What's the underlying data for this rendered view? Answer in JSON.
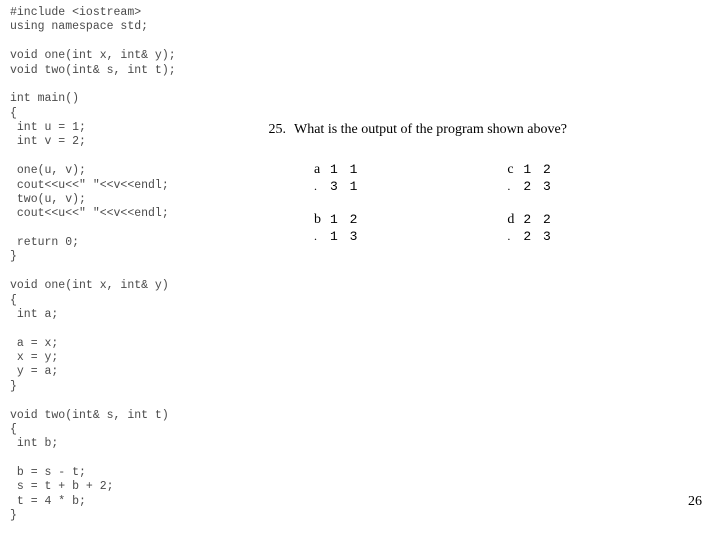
{
  "code": "#include <iostream>\nusing namespace std;\n\nvoid one(int x, int& y);\nvoid two(int& s, int t);\n\nint main()\n{\n int u = 1;\n int v = 2;\n\n one(u, v);\n cout<<u<<\" \"<<v<<endl;\n two(u, v);\n cout<<u<<\" \"<<v<<endl;\n\n return 0;\n}\n\nvoid one(int x, int& y)\n{\n int a;\n\n a = x;\n x = y;\n y = a;\n}\n\nvoid two(int& s, int t)\n{\n int b;\n\n b = s - t;\n s = t + b + 2;\n t = 4 * b;\n}",
  "question": {
    "number": "25.",
    "text": "What is the output of the program shown above?"
  },
  "choices": {
    "a": {
      "label": "a",
      "line1": "1 1",
      "line2": "3 1"
    },
    "b": {
      "label": "b",
      "line1": "1 2",
      "line2": "1 3"
    },
    "c": {
      "label": "c",
      "line1": "1 2",
      "line2": "2 3"
    },
    "d": {
      "label": "d",
      "line1": "2 2",
      "line2": "2 3"
    }
  },
  "pageNumber": "26"
}
